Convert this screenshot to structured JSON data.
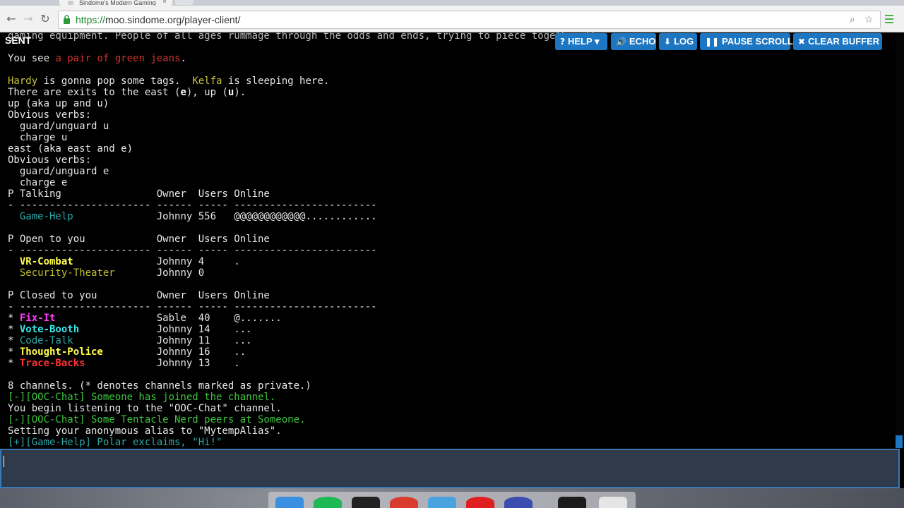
{
  "browser": {
    "tab_title": "Sindome's Modern Gaming",
    "tab_close": "×",
    "url_scheme": "https://",
    "url_rest": "moo.sindome.org/player-client/",
    "back_glyph": "←",
    "forward_glyph": "→",
    "reload_glyph": "↻",
    "zoom_glyph": "⌕",
    "star_glyph": "☆",
    "icons": {
      "back": "back-arrow-icon",
      "forward": "forward-arrow-icon",
      "reload": "reload-icon",
      "lock": "lock-icon",
      "zoom": "search-icon",
      "bookmark": "star-icon",
      "menu": "hamburger-menu-icon"
    }
  },
  "client": {
    "status": "SENT",
    "buttons": {
      "help": "HELP ▾",
      "echo": "ECHO",
      "log": "LOG",
      "pause_scroll": "PAUSE SCROLL",
      "clear_buffer": "CLEAR BUFFER"
    },
    "button_icons": {
      "help": "?",
      "echo": "🔊",
      "log": "⬇",
      "pause_scroll": "❚❚",
      "clear_buffer": "✖"
    },
    "input_value": "",
    "colors": {
      "accent": "#1d76c2",
      "input_bg": "#2f3b4a"
    }
  },
  "terminal": {
    "l0": "gaming equipment. People of all ages rummage through the odds and ends, trying to piece together the",
    "l1a": "You see ",
    "l1b": "a pair of green jeans",
    "l1c": ".",
    "l2a": "Hardy",
    "l2b": " is gonna pop some tags.  ",
    "l2c": "Kelfa",
    "l2d": " is sleeping here.",
    "l3a": "There are exits to the east (",
    "l3b": "e",
    "l3c": "), up (",
    "l3d": "u",
    "l3e": ").",
    "l4": "up (aka up and u)",
    "l5": "Obvious verbs:",
    "l6": "  guard/unguard u",
    "l7": "  charge u",
    "l8": "east (aka east and e)",
    "l9": "Obvious verbs:",
    "l10": "  guard/unguard e",
    "l11": "  charge e",
    "h1": "P Talking                Owner  Users Online",
    "sep": "- ---------------------- ------ ----- ------------------------",
    "talking": [
      {
        "prefix": "  ",
        "name": "Game-Help",
        "pad": "              ",
        "info": "Johnny 556   @@@@@@@@@@@@............"
      }
    ],
    "h2": "P Open to you            Owner  Users Online",
    "open": [
      {
        "prefix": "  ",
        "name": "VR-Combat",
        "pad": "              ",
        "info": "Johnny 4     ."
      },
      {
        "prefix": "  ",
        "name": "Security-Theater",
        "pad": "       ",
        "info": "Johnny 0"
      }
    ],
    "h3": "P Closed to you          Owner  Users Online",
    "closed": [
      {
        "prefix": "* ",
        "name": "Fix-It",
        "pad": "                 ",
        "info": "Sable  40    @......."
      },
      {
        "prefix": "* ",
        "name": "Vote-Booth",
        "pad": "             ",
        "info": "Johnny 14    ..."
      },
      {
        "prefix": "* ",
        "name": "Code-Talk",
        "pad": "              ",
        "info": "Johnny 11    ..."
      },
      {
        "prefix": "* ",
        "name": "Thought-Police",
        "pad": "         ",
        "info": "Johnny 16    .."
      },
      {
        "prefix": "* ",
        "name": "Trace-Backs",
        "pad": "            ",
        "info": "Johnny 13    ."
      }
    ],
    "summary": "8 channels. (* denotes channels marked as private.)",
    "c1": "[-][OOC-Chat] Someone has joined the channel.",
    "c2": "You begin listening to the \"OOC-Chat\" channel.",
    "c3": "[-][OOC-Chat] Some Tentacle Nerd peers at Someone.",
    "c4": "Setting your anonymous alias to \"MytempAlias\".",
    "c5": "[+][Game-Help] Polar exclaims, \"Hi!\""
  }
}
